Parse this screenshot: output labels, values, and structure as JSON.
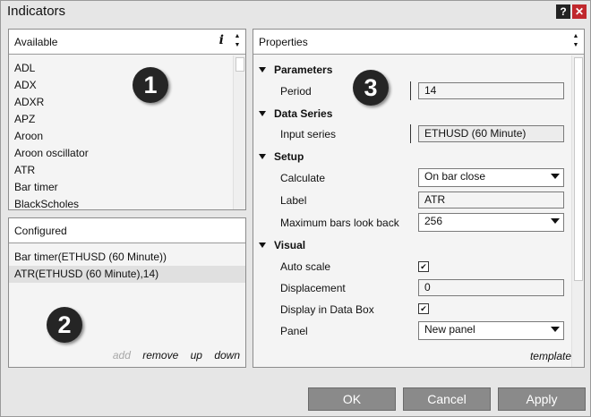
{
  "window": {
    "title": "Indicators",
    "help_label": "?",
    "close_label": "✕"
  },
  "available": {
    "header": "Available",
    "info_label": "i",
    "items": [
      "ADL",
      "ADX",
      "ADXR",
      "APZ",
      "Aroon",
      "Aroon oscillator",
      "ATR",
      "Bar timer",
      "BlackScholes"
    ]
  },
  "configured": {
    "header": "Configured",
    "items": [
      "Bar timer(ETHUSD (60 Minute))",
      "ATR(ETHUSD (60 Minute),14)"
    ],
    "actions": {
      "add": "add",
      "remove": "remove",
      "up": "up",
      "down": "down"
    }
  },
  "properties": {
    "header": "Properties",
    "categories": {
      "parameters": "Parameters",
      "data_series": "Data Series",
      "setup": "Setup",
      "visual": "Visual"
    },
    "fields": {
      "period": {
        "label": "Period",
        "value": "14"
      },
      "input_series": {
        "label": "Input series",
        "value": "ETHUSD (60 Minute)"
      },
      "calculate": {
        "label": "Calculate",
        "value": "On bar close"
      },
      "label": {
        "label": "Label",
        "value": "ATR"
      },
      "max_bars": {
        "label": "Maximum bars look back",
        "value": "256"
      },
      "auto_scale": {
        "label": "Auto scale",
        "checked": true
      },
      "displacement": {
        "label": "Displacement",
        "value": "0"
      },
      "data_box": {
        "label": "Display in Data Box",
        "checked": true
      },
      "panel": {
        "label": "Panel",
        "value": "New panel"
      }
    },
    "template_label": "template"
  },
  "badges": {
    "one": "1",
    "two": "2",
    "three": "3"
  },
  "buttons": {
    "ok": "OK",
    "cancel": "Cancel",
    "apply": "Apply"
  },
  "colors": {
    "close": "#c0282d",
    "button_bg": "#8a8a8a",
    "badge_bg": "#252525"
  }
}
